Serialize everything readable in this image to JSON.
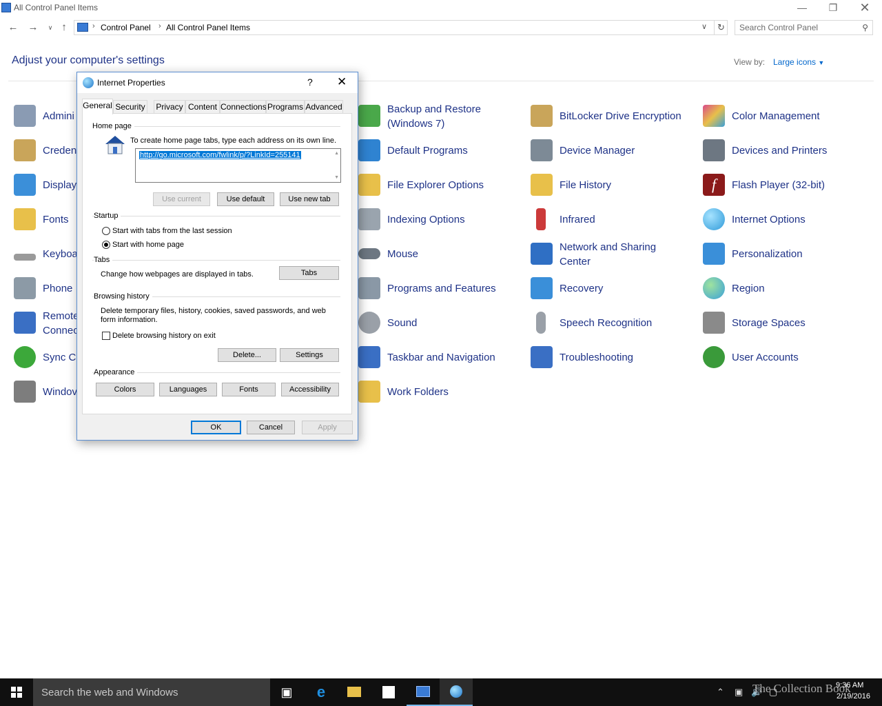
{
  "window": {
    "title": "All Control Panel Items"
  },
  "addressbar": {
    "crumbs": [
      "Control Panel",
      "All Control Panel Items"
    ],
    "search_placeholder": "Search Control Panel"
  },
  "header": {
    "title": "Adjust your computer's settings",
    "view_by_label": "View by:",
    "view_by_value": "Large icons"
  },
  "items": [
    {
      "label": "Administrative Tools",
      "visible_label": "Admini",
      "icon": "admin-tools-icon",
      "color": "#8a9bb3"
    },
    {
      "label": "Credential Manager",
      "visible_label": "Creden",
      "icon": "credential-icon",
      "color": "#c9a55a"
    },
    {
      "label": "Display",
      "visible_label": "Display",
      "icon": "display-icon",
      "color": "#3b8fd9"
    },
    {
      "label": "Fonts",
      "visible_label": "Fonts",
      "icon": "fonts-icon",
      "color": "#e8c04a"
    },
    {
      "label": "Keyboard",
      "visible_label": "Keyboa",
      "icon": "keyboard-icon",
      "color": "#9a9a9a"
    },
    {
      "label": "Phone and Modem",
      "visible_label": "Phone",
      "icon": "phone-icon",
      "color": "#8c9aa6"
    },
    {
      "label": "RemoteApp and Desktop Connections",
      "visible_label": "Remote Connec",
      "icon": "remote-icon",
      "color": "#3a6fc4"
    },
    {
      "label": "Sync Center",
      "visible_label": "Sync C",
      "icon": "sync-icon",
      "color": "#3ca83a"
    },
    {
      "label": "Windows Firewall",
      "visible_label": "Windov",
      "icon": "firewall-icon",
      "color": "#7d7d7d"
    },
    {
      "label": "Backup and Restore (Windows 7)",
      "icon": "backup-icon",
      "color": "#4aa84a"
    },
    {
      "label": "Default Programs",
      "icon": "default-programs-icon",
      "color": "#2f83d1"
    },
    {
      "label": "File Explorer Options",
      "icon": "folder-options-icon",
      "color": "#e8c04a"
    },
    {
      "label": "Indexing Options",
      "icon": "indexing-icon",
      "color": "#9aa4ae"
    },
    {
      "label": "Mouse",
      "icon": "mouse-icon",
      "color": "#6d7782"
    },
    {
      "label": "Programs and Features",
      "icon": "programs-features-icon",
      "color": "#8a98a6"
    },
    {
      "label": "Sound",
      "icon": "sound-icon",
      "color": "#9aa0a8"
    },
    {
      "label": "Taskbar and Navigation",
      "icon": "taskbar-icon",
      "color": "#3a6fc4"
    },
    {
      "label": "Work Folders",
      "icon": "work-folders-icon",
      "color": "#e8c04a"
    },
    {
      "label": "BitLocker Drive Encryption",
      "icon": "bitlocker-icon",
      "color": "#c9a55a"
    },
    {
      "label": "Device Manager",
      "icon": "device-manager-icon",
      "color": "#7d8a96"
    },
    {
      "label": "File History",
      "icon": "file-history-icon",
      "color": "#e8c04a"
    },
    {
      "label": "Infrared",
      "icon": "infrared-icon",
      "color": "#cc3a3a"
    },
    {
      "label": "Network and Sharing Center",
      "icon": "network-icon",
      "color": "#2f6fc4"
    },
    {
      "label": "Recovery",
      "icon": "recovery-icon",
      "color": "#3a8fd9"
    },
    {
      "label": "Speech Recognition",
      "icon": "microphone-icon",
      "color": "#9aa0a8"
    },
    {
      "label": "Troubleshooting",
      "icon": "troubleshooting-icon",
      "color": "#3a6fc4"
    },
    {
      "label": "Color Management",
      "icon": "color-management-icon",
      "color": "#d94a8a"
    },
    {
      "label": "Devices and Printers",
      "icon": "printer-icon",
      "color": "#6d7782"
    },
    {
      "label": "Flash Player (32-bit)",
      "icon": "flash-icon",
      "color": "#8b1a1a"
    },
    {
      "label": "Internet Options",
      "icon": "internet-options-icon",
      "color": "#2f9ad9"
    },
    {
      "label": "Personalization",
      "icon": "personalization-icon",
      "color": "#3a8fd9"
    },
    {
      "label": "Region",
      "icon": "region-icon",
      "color": "#3aa0d9"
    },
    {
      "label": "Storage Spaces",
      "icon": "storage-icon",
      "color": "#8a8a8a"
    },
    {
      "label": "User Accounts",
      "icon": "user-accounts-icon",
      "color": "#3a9a3a"
    }
  ],
  "dialog": {
    "title": "Internet Properties",
    "help": "?",
    "tabs": [
      "General",
      "Security",
      "Privacy",
      "Content",
      "Connections",
      "Programs",
      "Advanced"
    ],
    "home_page": {
      "group": "Home page",
      "instruction": "To create home page tabs, type each address on its own line.",
      "url": "http://go.microsoft.com/fwlink/p/?LinkId=255141",
      "use_current": "Use current",
      "use_default": "Use default",
      "use_new_tab": "Use new tab"
    },
    "startup": {
      "group": "Startup",
      "option_last_session": "Start with tabs from the last session",
      "option_home_page": "Start with home page",
      "selected": "Start with home page"
    },
    "tabs_group": {
      "group": "Tabs",
      "text": "Change how webpages are displayed in tabs.",
      "button": "Tabs"
    },
    "browsing_history": {
      "group": "Browsing history",
      "text_line1": "Delete temporary files, history, cookies, saved passwords, and web",
      "text_line2": "form information.",
      "checkbox": "Delete browsing history on exit",
      "checked": false,
      "delete": "Delete...",
      "settings": "Settings"
    },
    "appearance": {
      "group": "Appearance",
      "colors": "Colors",
      "languages": "Languages",
      "fonts": "Fonts",
      "accessibility": "Accessibility"
    },
    "footer": {
      "ok": "OK",
      "cancel": "Cancel",
      "apply": "Apply"
    }
  },
  "taskbar": {
    "search_placeholder": "Search the web and Windows",
    "time": "9:36 AM",
    "date": "2/19/2016",
    "watermark": "The Collection Book"
  }
}
